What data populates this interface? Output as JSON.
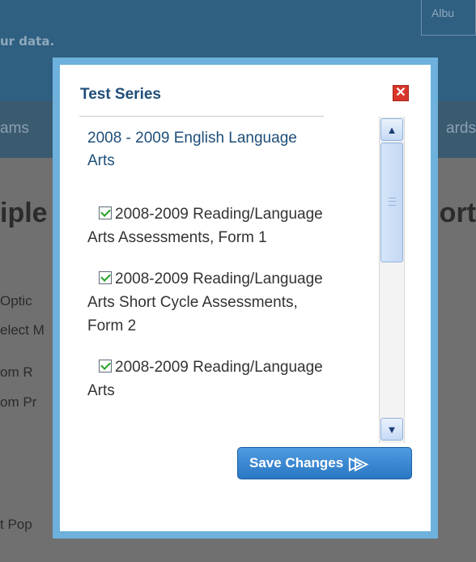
{
  "background": {
    "top_note": "ur data.",
    "top_input": "Albu",
    "nav_left": "ams",
    "nav_right": "ards",
    "heading_left": "iple",
    "heading_right": "ort",
    "options": [
      "Optic",
      "elect M",
      "om R",
      "om Pr",
      "t Pop"
    ]
  },
  "dialog": {
    "title": "Test Series",
    "close_icon": "close-x-icon",
    "group_title": "2008 - 2009 English Language Arts",
    "items": [
      {
        "label": "2008-2009 Reading/Language Arts Assessments, Form 1",
        "checked": true
      },
      {
        "label": "2008-2009 Reading/Language Arts Short Cycle Assessments, Form 2",
        "checked": true
      },
      {
        "label": "2008-2009 Reading/Language Arts",
        "checked": true
      }
    ],
    "save_label": "Save Changes",
    "save_icon": "double-chevron-right-icon"
  },
  "colors": {
    "dialog_frame": "#6db1dc",
    "title": "#1f4e79",
    "save_button": "#2a77c4",
    "close_button": "#d9362b"
  }
}
